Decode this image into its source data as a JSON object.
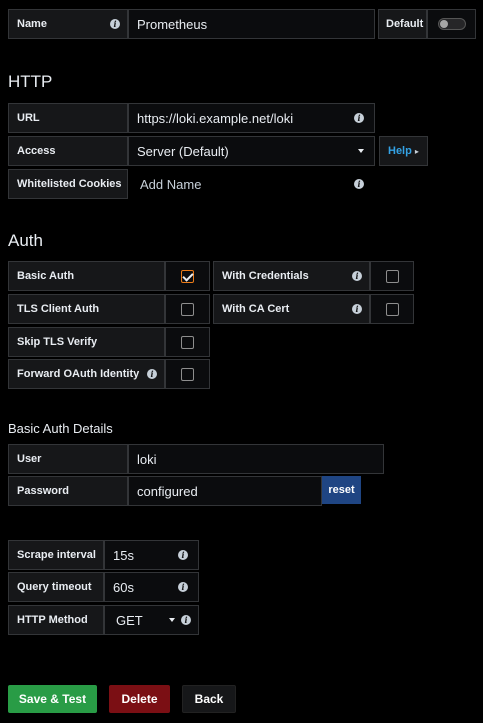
{
  "name_row": {
    "label": "Name",
    "value": "Prometheus",
    "default_label": "Default",
    "default_enabled": false
  },
  "http": {
    "heading": "HTTP",
    "url_label": "URL",
    "url_value": "https://loki.example.net/loki",
    "access_label": "Access",
    "access_value": "Server (Default)",
    "help_label": "Help",
    "help_caret": "▸",
    "cookies_label": "Whitelisted Cookies",
    "cookies_placeholder": "Add Name"
  },
  "auth": {
    "heading": "Auth",
    "options": {
      "basic_auth": {
        "label": "Basic Auth",
        "checked": true
      },
      "with_credentials": {
        "label": "With Credentials",
        "checked": false
      },
      "tls_client_auth": {
        "label": "TLS Client Auth",
        "checked": false
      },
      "with_ca_cert": {
        "label": "With CA Cert",
        "checked": false
      },
      "skip_tls_verify": {
        "label": "Skip TLS Verify",
        "checked": false
      },
      "forward_oauth": {
        "label": "Forward OAuth Identity",
        "checked": false
      }
    }
  },
  "basic_auth_details": {
    "heading": "Basic Auth Details",
    "user_label": "User",
    "user_value": "loki",
    "password_label": "Password",
    "password_value": "configured",
    "reset_label": "reset"
  },
  "query_settings": {
    "scrape_label": "Scrape interval",
    "scrape_value": "15s",
    "timeout_label": "Query timeout",
    "timeout_value": "60s",
    "method_label": "HTTP Method",
    "method_value": "GET"
  },
  "actions": {
    "save_label": "Save & Test",
    "delete_label": "Delete",
    "back_label": "Back"
  },
  "icons": {
    "info": "info-icon",
    "caret": "caret-down-icon",
    "checkmark": "checkmark-icon"
  },
  "colors": {
    "background": "#000000",
    "save": "#299c46",
    "delete": "#7b0f14",
    "reset": "#1f4583",
    "checkbox_accent": "#eb7b18",
    "help_text": "#33a2e5"
  }
}
